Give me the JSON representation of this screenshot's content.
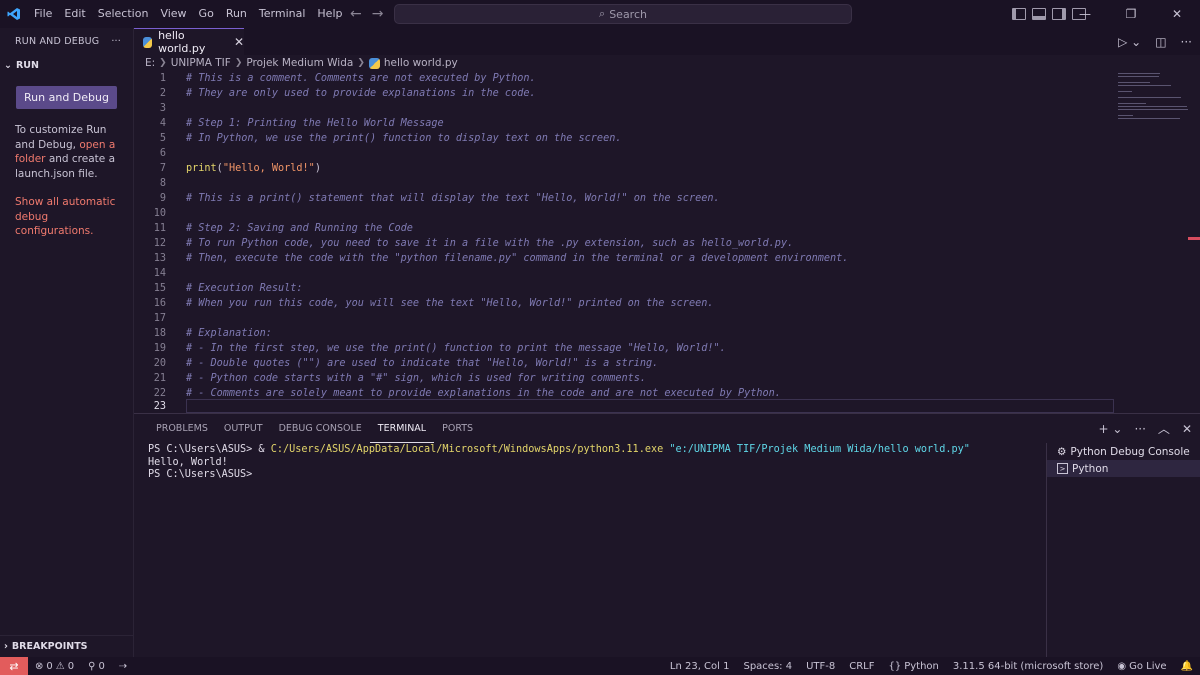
{
  "titlebar": {
    "app_icon": "vscode-logo",
    "menu": [
      "File",
      "Edit",
      "Selection",
      "View",
      "Go",
      "Run",
      "Terminal",
      "Help"
    ],
    "search_label": "Search",
    "window_controls": [
      "—",
      "❐",
      "✕"
    ]
  },
  "sidebar": {
    "header": "RUN AND DEBUG",
    "more": "···",
    "section": "RUN",
    "run_button": "Run and Debug",
    "text_1": "To customize Run and Debug, ",
    "link_open_folder": "open a folder",
    "text_2": " and create a launch.json file.",
    "link_show_all": "Show all automatic debug configurations.",
    "breakpoints": "BREAKPOINTS"
  },
  "editor": {
    "tab_label": "hello world.py",
    "tab_close": "✕",
    "breadcrumb": [
      "E:",
      "UNIPMA TIF",
      "Projek Medium Wida",
      "hello world.py"
    ],
    "lines": [
      {
        "n": "1",
        "text": "# This is a comment. Comments are not executed by Python."
      },
      {
        "n": "2",
        "text": "# They are only used to provide explanations in the code."
      },
      {
        "n": "3",
        "text": ""
      },
      {
        "n": "4",
        "text": "# Step 1: Printing the Hello World Message"
      },
      {
        "n": "5",
        "text": "# In Python, we use the print() function to display text on the screen."
      },
      {
        "n": "6",
        "text": ""
      },
      {
        "n": "7",
        "fn": "print",
        "open": "(",
        "str": "\"Hello, World!\"",
        "close": ")"
      },
      {
        "n": "8",
        "text": ""
      },
      {
        "n": "9",
        "text": "# This is a print() statement that will display the text \"Hello, World!\" on the screen."
      },
      {
        "n": "10",
        "text": ""
      },
      {
        "n": "11",
        "text": "# Step 2: Saving and Running the Code"
      },
      {
        "n": "12",
        "text": "# To run Python code, you need to save it in a file with the .py extension, such as hello_world.py."
      },
      {
        "n": "13",
        "text": "# Then, execute the code with the \"python filename.py\" command in the terminal or a development environment."
      },
      {
        "n": "14",
        "text": ""
      },
      {
        "n": "15",
        "text": "# Execution Result:"
      },
      {
        "n": "16",
        "text": "# When you run this code, you will see the text \"Hello, World!\" printed on the screen."
      },
      {
        "n": "17",
        "text": ""
      },
      {
        "n": "18",
        "text": "# Explanation:"
      },
      {
        "n": "19",
        "text": "# - In the first step, we use the print() function to print the message \"Hello, World!\"."
      },
      {
        "n": "20",
        "text": "# - Double quotes (\"\") are used to indicate that \"Hello, World!\" is a string."
      },
      {
        "n": "21",
        "text": "# - Python code starts with a \"#\" sign, which is used for writing comments."
      },
      {
        "n": "22",
        "text": "# - Comments are solely meant to provide explanations in the code and are not executed by Python."
      },
      {
        "n": "23",
        "text": ""
      }
    ]
  },
  "panel": {
    "tabs": [
      "PROBLEMS",
      "OUTPUT",
      "DEBUG CONSOLE",
      "TERMINAL",
      "PORTS"
    ],
    "active_tab": "TERMINAL",
    "terminal": {
      "prompt": "PS C:\\Users\\ASUS> ",
      "cmd_amp": "& ",
      "cmd_path": "C:/Users/ASUS/AppData/Local/Microsoft/WindowsApps/python3.11.exe",
      "cmd_arg": "\"e:/UNIPMA TIF/Projek Medium Wida/hello world.py\"",
      "output": "Hello, World!",
      "prompt_2": "PS C:\\Users\\ASUS>"
    },
    "terminal_list": [
      "Python Debug Console",
      "Python"
    ]
  },
  "statusbar": {
    "errors": "0",
    "warnings": "0",
    "ports": "0",
    "position": "Ln 23, Col 1",
    "spaces": "Spaces: 4",
    "encoding": "UTF-8",
    "eol": "CRLF",
    "language": "Python",
    "interpreter": "3.11.5 64-bit (microsoft store)",
    "golive": "Go Live"
  }
}
